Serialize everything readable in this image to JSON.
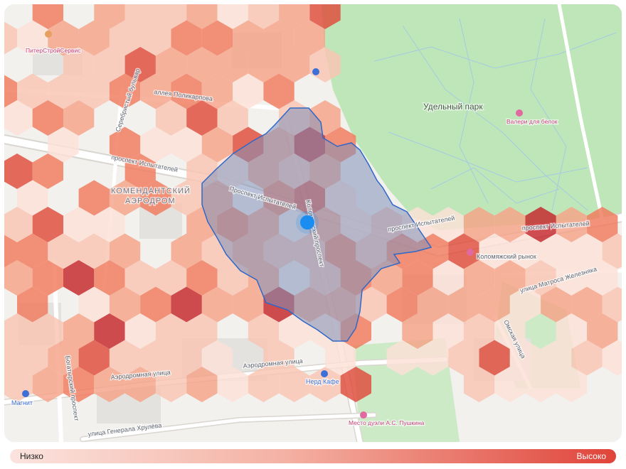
{
  "colors": {
    "map_background": "#f2f1ee",
    "park_green": "#bfe6b8",
    "road_white": "#ffffff",
    "road_outline": "#d9d6d0",
    "isochrone_fill": "#7f8fb8",
    "isochrone_stroke": "#2f68c8",
    "user_location": "#1c8df0",
    "legend_low": "#fbe3de",
    "legend_high": "#e0443a",
    "heat_levels": [
      "#fde1d7",
      "#f9c4b2",
      "#f5a288",
      "#f07a5d",
      "#df4a3a",
      "#c4242a"
    ]
  },
  "park": {
    "name": "Удельный парк"
  },
  "district": {
    "line1": "КОМЕНДАНТСКИЙ",
    "line2": "АЭРОДРОМ"
  },
  "streets": {
    "ispytateley_1": "проспект Испытателей",
    "ispytateley_2": "Проспект Испытателей",
    "ispytateley_3": "проспект Испытателей",
    "ispytateley_4": "проспект Испытателей",
    "kolomyazhsky": "Коломяжский проспект",
    "serebristy": "Серебристый бульвар",
    "aerodromnaya_1": "Аэродромная улица",
    "aerodromnaya_2": "Аэродромная улица",
    "khrulyova": "улица Генерала Хрулёва",
    "bogatyrsky": "Богатырский проспект",
    "omskaya": "Омская улица",
    "zheleznyaka": "улица Матроса Железняка",
    "polikarpova": "аллея Поликарпова"
  },
  "pois": {
    "kolomyazhsky_market": "Коломяжский рынок",
    "nerd_kafe": "Нерд Кафе",
    "magnit": "Магнит",
    "valeri": "Валери для белок",
    "prostroy": "ПитерСтройСервис",
    "pushkin": "Место дуэли А.С. Пушкина"
  },
  "legend": {
    "low": "Низко",
    "high": "Высоко"
  }
}
